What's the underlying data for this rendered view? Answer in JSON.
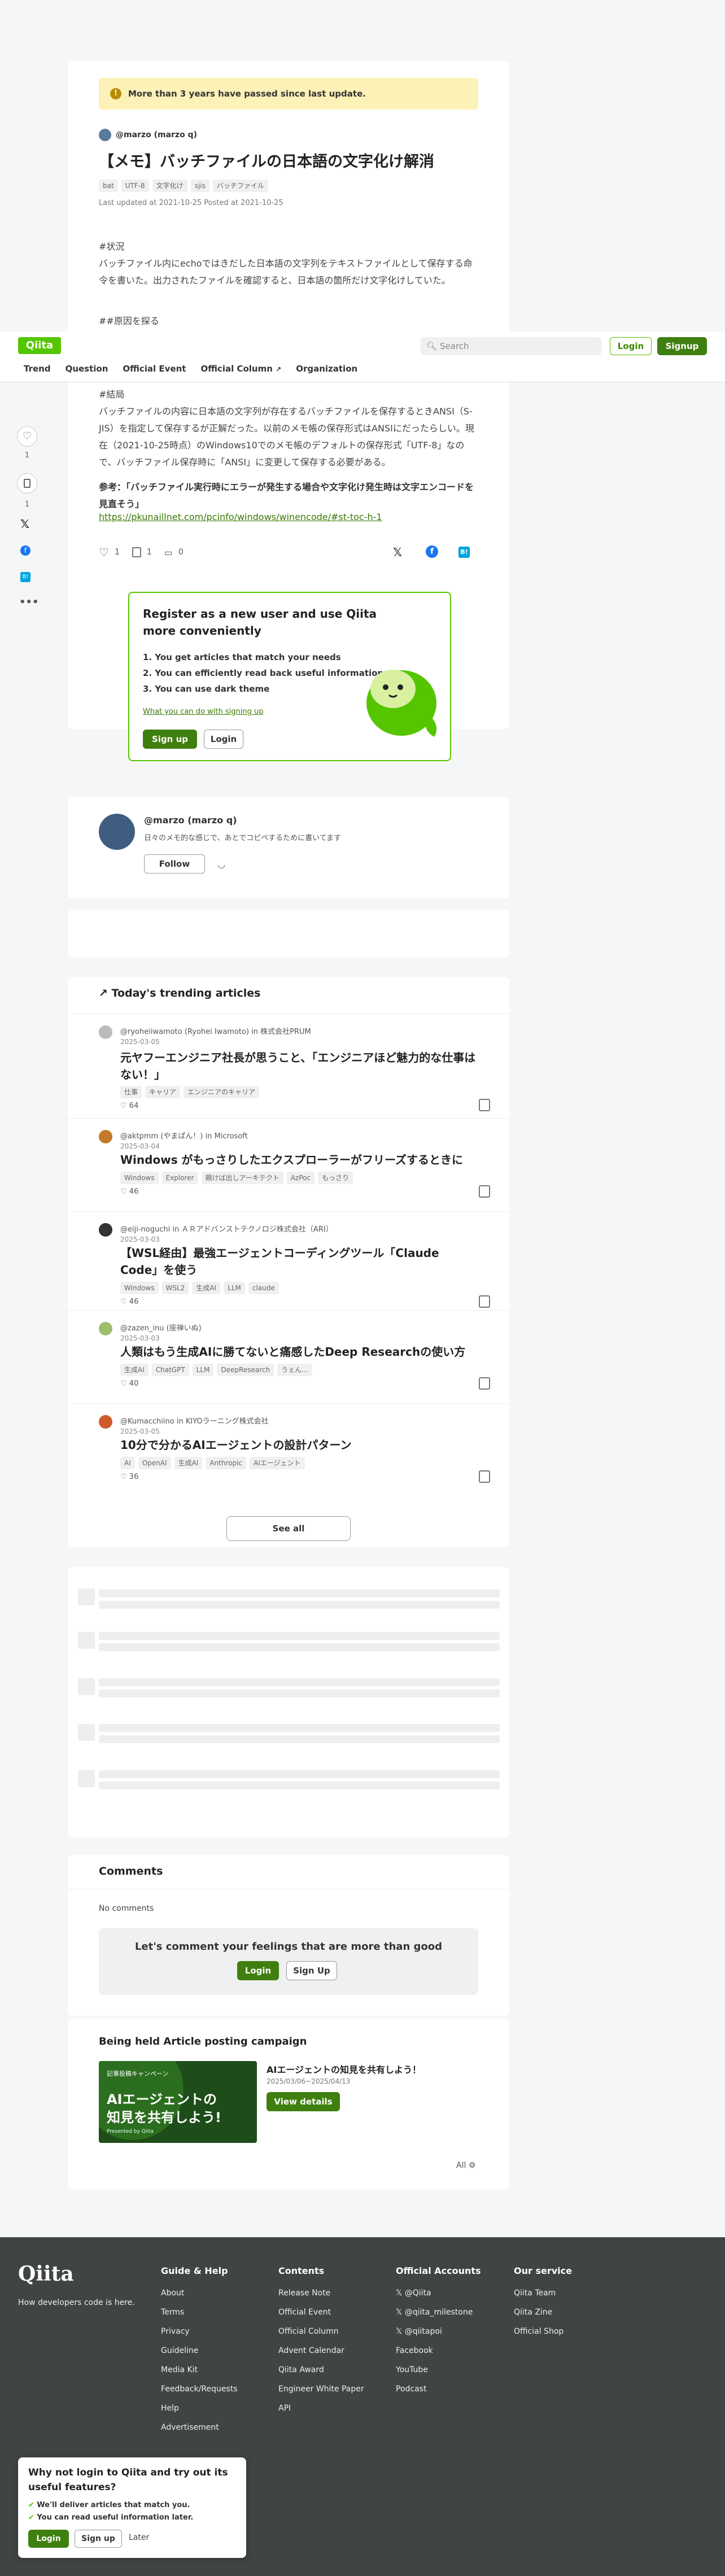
{
  "notice": "More than 3 years have passed since last update.",
  "article": {
    "author": "@marzo (marzo q)",
    "title": "【メモ】バッチファイルの日本語の文字化け解消",
    "tags": [
      "bat",
      "UTF-8",
      "文字化け",
      "sjis",
      "バッチファイル"
    ],
    "dates": "Last updated at 2021-10-25  Posted at 2021-10-25",
    "p1_head": "#状況",
    "p1": "バッチファイル内にechoではきだした日本語の文字列をテキストファイルとして保存する命令を書いた。出力されたファイルを確認すると、日本語の箇所だけ文字化けしていた。",
    "p2_head": "##原因を探る",
    "p3_head": "#結局",
    "p3": "バッチファイルの内容に日本語の文字列が存在するバッチファイルを保存するときANSI（S-JIS）を指定して保存するが正解だった。以前のメモ帳の保存形式はANSIにだったらしい。現在（2021-10-25時点）のWindows10でのメモ帳のデフォルトの保存形式「UTF-8」なので、バッチファイル保存時に「ANSI」に変更して保存する必要がある。",
    "ref": "参考：「バッチファイル実行時にエラーが発生する場合や文字化け発生時は文字エンコードを見直そう」",
    "ref_link": "https://pkunaillnet.com/pcinfo/windows/winencode/#st-toc-h-1",
    "likes": "1",
    "stocks": "1",
    "comments_count": "0",
    "side_like": "1",
    "side_stock": "1"
  },
  "header": {
    "logo": "Qiita",
    "search_placeholder": "Search",
    "login": "Login",
    "signup": "Signup",
    "nav": [
      "Trend",
      "Question",
      "Official Event",
      "Official Column",
      "Organization"
    ]
  },
  "register": {
    "title": "Register as a new user and use Qiita more conveniently",
    "items": [
      "1. You get articles that match your needs",
      "2. You can efficiently read back useful information",
      "3. You can use dark theme"
    ],
    "link": "What you can do with signing up",
    "signup": "Sign up",
    "login": "Login"
  },
  "profile": {
    "name": "@marzo (marzo q)",
    "bio": "日々のメモ的な感じで、あとでコピペするために書いてます",
    "follow": "Follow"
  },
  "trending": {
    "title": "Today's trending articles",
    "items": [
      {
        "author": "@ryoheiiwamoto (Ryohei Iwamoto) in 株式会社PRUM",
        "date": "2025-03-05",
        "title": "元ヤフーエンジニア社長が思うこと、「エンジニアほど魅力的な仕事はない！」",
        "tags": [
          "仕事",
          "キャリア",
          "エンジニアのキャリア"
        ],
        "likes": "64"
      },
      {
        "author": "@aktpmm (やまぱん！) in Microsoft",
        "date": "2025-03-04",
        "title": "Windows がもっさりしたエクスプローラーがフリーズするときに",
        "tags": [
          "Windows",
          "Explorer",
          "親けば出しアーキテクト",
          "AzPoc",
          "もっさり"
        ],
        "likes": "46"
      },
      {
        "author": "@eiji-noguchi in ＡＲアドバンストテクノロジ株式会社（ARI）",
        "date": "2025-03-03",
        "title": "【WSL経由】最強エージェントコーディングツール「Claude Code」を使う",
        "tags": [
          "Windows",
          "WSL2",
          "生成AI",
          "LLM",
          "claude"
        ],
        "likes": "46"
      },
      {
        "author": "@zazen_inu (座禅いぬ)",
        "date": "2025-03-03",
        "title": "人類はもう生成AIに勝てないと痛感したDeep Researchの使い方",
        "tags": [
          "生成AI",
          "ChatGPT",
          "LLM",
          "DeepResearch",
          "うぇん..."
        ],
        "likes": "40"
      },
      {
        "author": "@Kumacchiino in KIYOラーニング株式会社",
        "date": "2025-03-05",
        "title": "10分で分かるAIエージェントの設計パターン",
        "tags": [
          "AI",
          "OpenAI",
          "生成AI",
          "Anthropic",
          "AIエージェント"
        ],
        "likes": "36"
      }
    ],
    "see_all": "See all"
  },
  "comments": {
    "title": "Comments",
    "none": "No comments",
    "prompt": "Let's comment your feelings that are more than good",
    "login": "Login",
    "signup": "Sign Up"
  },
  "campaign": {
    "title": "Being held Article posting campaign",
    "banner_line1": "AIエージェントの",
    "banner_line2": "知見を共有しよう!",
    "banner_top": "記事投稿キャンペーン",
    "banner_by": "Presented by Qiita",
    "name": "AIエージェントの知見を共有しよう！",
    "dates": "2025/03/06~2025/04/13",
    "button": "View details",
    "all": "All"
  },
  "footer": {
    "logo": "Qiita",
    "tagline": "How developers code is here.",
    "cols": [
      {
        "title": "Guide & Help",
        "items": [
          "About",
          "Terms",
          "Privacy",
          "Guideline",
          "Media Kit",
          "Feedback/Requests",
          "Help",
          "Advertisement"
        ]
      },
      {
        "title": "Contents",
        "items": [
          "Release Note",
          "Official Event",
          "Official Column",
          "Advent Calendar",
          "Qiita Award",
          "Engineer White Paper",
          "API"
        ]
      },
      {
        "title": "Official Accounts",
        "items": [
          "@Qiita",
          "@qiita_milestone",
          "@qiitapoi",
          "Facebook",
          "YouTube",
          "Podcast"
        ]
      },
      {
        "title": "Our service",
        "items": [
          "Qiita Team",
          "Qiita Zine",
          "Official Shop"
        ]
      }
    ]
  },
  "popup": {
    "title": "Why not login to Qiita and try out its useful features?",
    "items": [
      "We'll deliver articles that match you.",
      "You can read useful information later."
    ],
    "login": "Login",
    "signup": "Sign up",
    "later": "Later"
  },
  "colors": {
    "brand": "#55c500",
    "button": "#3f7f0f",
    "footer": "#404444",
    "notice": "#fcf1b6"
  }
}
